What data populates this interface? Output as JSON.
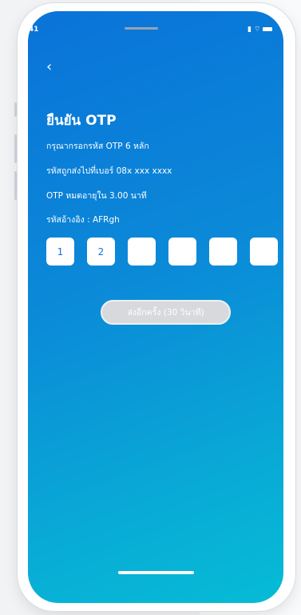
{
  "status": {
    "time": "9:41",
    "signal_icon": "signal-icon",
    "wifi_icon": "wifi-icon",
    "battery_icon": "battery-icon"
  },
  "nav": {
    "back_glyph": "‹"
  },
  "otp": {
    "title": "ยืนยัน OTP",
    "line1": "กรุณากรอกรหัส OTP 6 หลัก",
    "line2": "รหัสถูกส่งไปที่เบอร์ 08x xxx xxxx",
    "line3": "OTP หมดอายุใน 3.00 นาที",
    "line4": "รหัสอ้างอิง : AFRgh",
    "digits": [
      "1",
      "2",
      "",
      "",
      "",
      ""
    ]
  },
  "resend": {
    "label": "ส่งอีกครั้ง (30 วินาที)"
  },
  "colors": {
    "gradient_start": "#0a73d9",
    "gradient_end": "#06bcd5",
    "button_disabled": "#d7d9dc"
  }
}
